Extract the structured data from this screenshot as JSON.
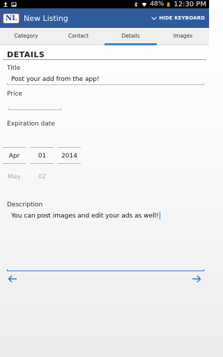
{
  "status_bar": {
    "battery": "48%",
    "time": "12:30 PM"
  },
  "action_bar": {
    "logo_text": "NL",
    "title": "New Listing",
    "hide_keyboard_label": "HIDE KEYBOARD"
  },
  "tabs": [
    {
      "label": "Category",
      "active": false
    },
    {
      "label": "Contact",
      "active": false
    },
    {
      "label": "Details",
      "active": true
    },
    {
      "label": "Images",
      "active": false
    }
  ],
  "details": {
    "header": "DETAILS",
    "title_label": "Title",
    "title_value": "Post your add from the app!",
    "price_label": "Price",
    "price_value": "",
    "expiration_label": "Expiration date",
    "date": {
      "month": "Apr",
      "day": "01",
      "year": "2014",
      "next_month": "May",
      "next_day": "02"
    },
    "description_label": "Description",
    "description_value": "You can post images and edit your ads as well!"
  },
  "colors": {
    "action_bar": "#2f5b9c",
    "accent": "#3a87c8",
    "text_field_active": "#2f73c9"
  },
  "icons": {
    "back_arrow": "arrow-left-icon",
    "next_arrow": "arrow-right-icon",
    "hide_keyboard": "chevron-down-icon"
  }
}
